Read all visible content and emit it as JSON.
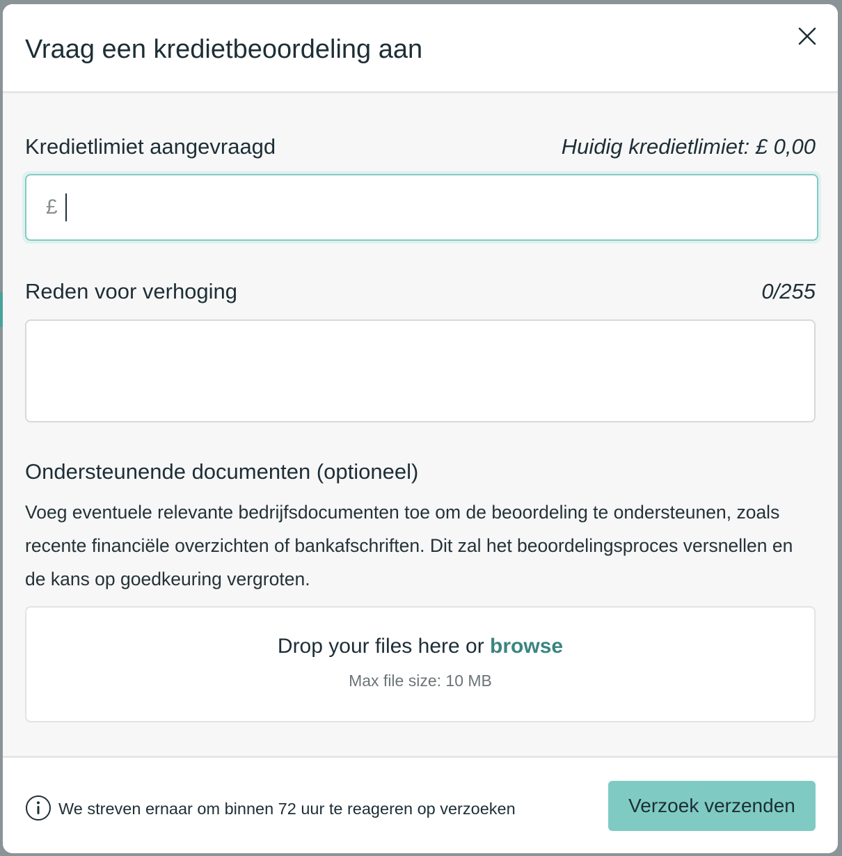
{
  "modal": {
    "title": "Vraag een kredietbeoordeling aan",
    "close_icon": "close-icon"
  },
  "credit_limit": {
    "label": "Kredietlimiet aangevraagd",
    "current_limit": "Huidig kredietlimiet: £ 0,00",
    "currency_symbol": "£",
    "value": ""
  },
  "reason": {
    "label": "Reden voor verhoging",
    "counter": "0/255",
    "value": ""
  },
  "documents": {
    "title": "Ondersteunende documenten (optioneel)",
    "description": "Voeg eventuele relevante bedrijfsdocumenten toe om de beoordeling te ondersteunen, zoals recente financiële overzichten of bankafschriften. Dit zal het beoordelingsproces versnellen en de kans op goedkeuring vergroten.",
    "dropzone": {
      "prompt": "Drop your files here or",
      "browse_label": "browse",
      "max_size": "Max file size: 10 MB"
    }
  },
  "footer": {
    "info_icon": "info-icon",
    "note": "We streven ernaar om binnen 72 uur te reageren op verzoeken",
    "submit_label": "Verzoek verzenden"
  },
  "colors": {
    "accent": "#7fcbc3",
    "link": "#3a8580",
    "text": "#1d2e36"
  }
}
